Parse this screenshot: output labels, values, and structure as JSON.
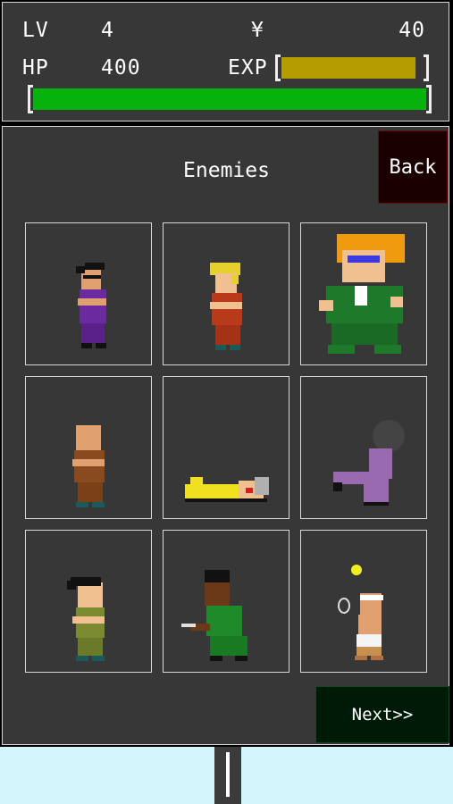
{
  "stats": {
    "lv_label": "LV",
    "lv_value": "4",
    "money_label": "¥",
    "money_value": "40",
    "hp_label": "HP",
    "hp_value": "400",
    "exp_label": "EXP",
    "exp_fraction": 0.95,
    "hp_fraction": 1.0,
    "colors": {
      "exp": "#b59c00",
      "hp": "#08b20c"
    }
  },
  "panel": {
    "title": "Enemies",
    "back_label": "Back",
    "next_label": "Next>>"
  },
  "enemies": [
    {
      "icon": "enemy-purple-thug-icon"
    },
    {
      "icon": "enemy-blonde-thug-icon"
    },
    {
      "icon": "enemy-boss-green-icon"
    },
    {
      "icon": "enemy-bald-brown-icon"
    },
    {
      "icon": "enemy-knocked-down-yellow-icon"
    },
    {
      "icon": "enemy-purple-kicker-icon"
    },
    {
      "icon": "enemy-olive-thug-icon"
    },
    {
      "icon": "enemy-knife-green-icon"
    },
    {
      "icon": "enemy-tennis-player-icon"
    }
  ]
}
